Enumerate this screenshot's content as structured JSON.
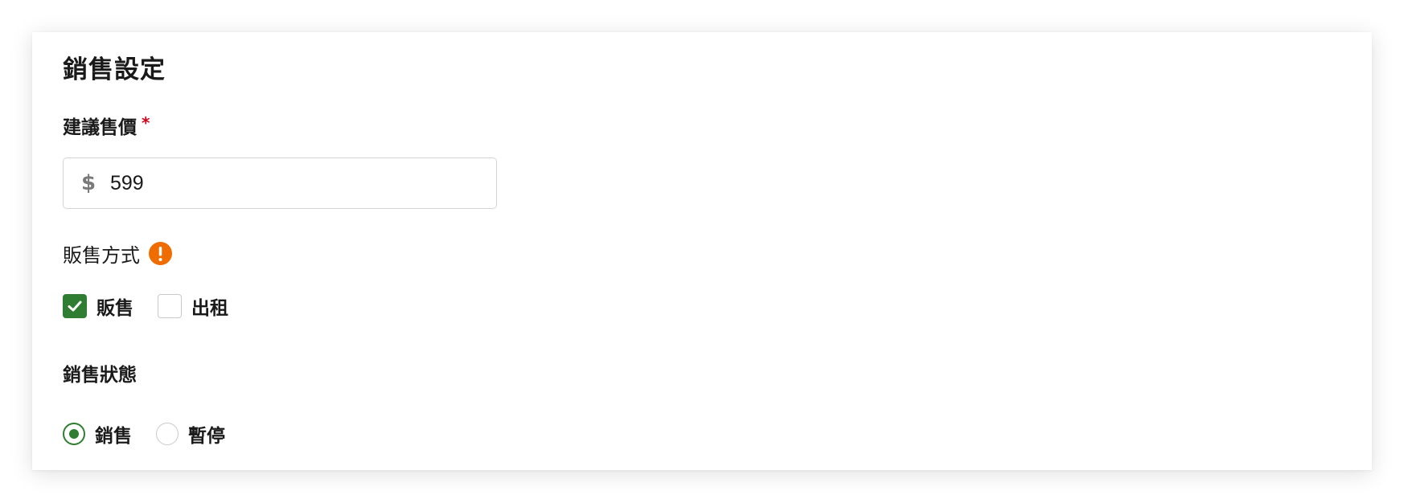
{
  "section": {
    "title": "銷售設定"
  },
  "price": {
    "label": "建議售價",
    "required_mark": "*",
    "currency_symbol": "$",
    "value": "599"
  },
  "sale_method": {
    "label": "販售方式",
    "warning_icon": "exclamation-circle-icon",
    "options": [
      {
        "label": "販售",
        "checked": true
      },
      {
        "label": "出租",
        "checked": false
      }
    ]
  },
  "sale_status": {
    "label": "銷售狀態",
    "options": [
      {
        "label": "銷售",
        "selected": true
      },
      {
        "label": "暫停",
        "selected": false
      }
    ]
  },
  "colors": {
    "accent_green": "#2e7d32",
    "warning_orange": "#ef6c00",
    "required_red": "#d0021b",
    "border_gray": "#d4d4d4"
  }
}
